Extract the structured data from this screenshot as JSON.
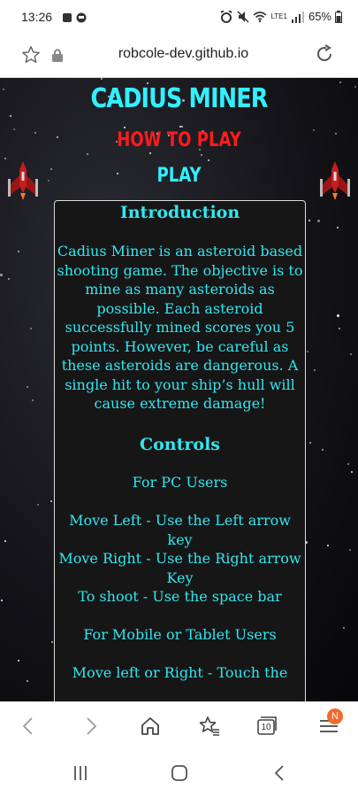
{
  "status": {
    "time": "13:26",
    "battery": "65%",
    "network_label": "LTE1"
  },
  "browser": {
    "url": "robcole-dev.github.io",
    "tabs_count": "10",
    "notification_badge": "N"
  },
  "game": {
    "title": "CADIUS MINER",
    "how_to_play": "HOW TO PLAY",
    "play": "PLAY"
  },
  "instructions": {
    "intro_heading": "Introduction",
    "intro_text": "Cadius Miner is an asteroid based shooting game. The objective is to mine as many asteroids as possible. Each asteroid successfully mined scores you 5 points. However, be careful as these asteroids are dangerous. A single hit to your ship’s hull will cause extreme damage!",
    "controls_heading": "Controls",
    "pc_users": "For PC Users",
    "move_left": "Move Left - Use the Left arrow key",
    "move_right": "Move Right - Use the Right arrow Key",
    "shoot": "To shoot - Use the space bar",
    "mobile_users": "For Mobile or Tablet Users",
    "mobile_move": "Move left or Right - Touch the"
  },
  "colors": {
    "title_cyan": "#33f0ff",
    "how_to_play_red": "#ff1b1b",
    "panel_bg": "#161616",
    "badge_orange": "#f26a2e"
  }
}
